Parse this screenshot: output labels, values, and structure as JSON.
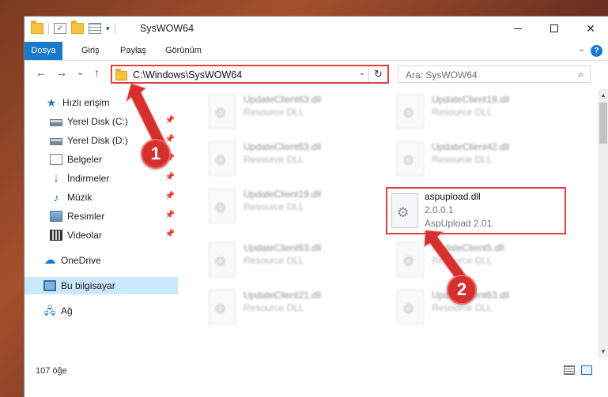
{
  "window": {
    "title": "SysWOW64",
    "controls": {
      "minimize": "minimize",
      "maximize": "maximize",
      "close": "✕"
    }
  },
  "ribbon": {
    "tabs": [
      "Dosya",
      "Giriş",
      "Paylaş",
      "Görünüm"
    ],
    "help": "?"
  },
  "navigation": {
    "back": "←",
    "forward": "→",
    "recent": "⌄",
    "up": "↑",
    "address": "C:\\Windows\\SysWOW64",
    "refresh": "↻",
    "search_placeholder": "Ara: SysWOW64"
  },
  "sidebar": {
    "quick_access": "Hızlı erişim",
    "items": [
      {
        "label": "Yerel Disk (C:)",
        "icon": "disk-icon",
        "pinned": true
      },
      {
        "label": "Yerel Disk (D:)",
        "icon": "disk-icon",
        "pinned": true
      },
      {
        "label": "Belgeler",
        "icon": "documents-icon",
        "pinned": true
      },
      {
        "label": "İndirmeler",
        "icon": "downloads-icon",
        "pinned": true
      },
      {
        "label": "Müzik",
        "icon": "music-icon",
        "pinned": true
      },
      {
        "label": "Resimler",
        "icon": "pictures-icon",
        "pinned": true
      },
      {
        "label": "Videolar",
        "icon": "videos-icon",
        "pinned": true
      }
    ],
    "onedrive": "OneDrive",
    "this_pc": "Bu bilgisayar",
    "network": "Ağ"
  },
  "files": [
    {
      "name": "UpdateClient63.dll",
      "desc": "Resource DLL",
      "blurred": true
    },
    {
      "name": "UpdateClient19.dll",
      "desc": "Resource DLL",
      "blurred": true
    },
    {
      "name": "UpdateClient63.dll",
      "desc": "Resource DLL",
      "blurred": true
    },
    {
      "name": "UpdateClient42.dll",
      "desc": "Resource DLL",
      "blurred": true
    },
    {
      "name": "UpdateClient19.dll",
      "desc": "Resource DLL",
      "blurred": true
    },
    {
      "name": "aspupload.dll",
      "desc": "2.0.0.1",
      "extra": "AspUpload 2.01",
      "blurred": false
    },
    {
      "name": "UpdateClient63.dll",
      "desc": "Resource DLL",
      "blurred": true
    },
    {
      "name": "UpdateClient5.dll",
      "desc": "Resource DLL",
      "blurred": true
    },
    {
      "name": "UpdateClient21.dll",
      "desc": "Resource DLL",
      "blurred": true
    },
    {
      "name": "UpdateClient63.dll",
      "desc": "Resource DLL",
      "blurred": true
    }
  ],
  "status": {
    "count": "107 öğe"
  },
  "annotations": [
    "1",
    "2"
  ],
  "colors": {
    "accent": "#1979ca",
    "highlight": "#e0403c",
    "selected": "#cce8ff"
  }
}
